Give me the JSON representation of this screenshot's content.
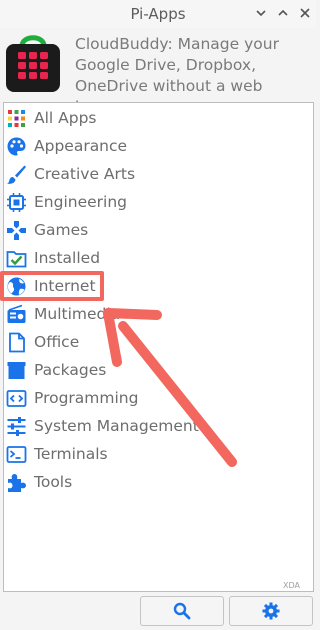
{
  "window": {
    "title": "Pi-Apps",
    "controls": [
      "chevron-down-icon",
      "chevron-up-icon",
      "close-icon"
    ]
  },
  "header": {
    "app_icon": "pi-apps-store-bag-icon",
    "description": "CloudBuddy: Manage your Google Drive, Dropbox, OneDrive without a web browser."
  },
  "categories": [
    {
      "label": "All Apps",
      "icon": "grid-icon"
    },
    {
      "label": "Appearance",
      "icon": "palette-icon"
    },
    {
      "label": "Creative Arts",
      "icon": "brush-icon"
    },
    {
      "label": "Engineering",
      "icon": "chip-icon"
    },
    {
      "label": "Games",
      "icon": "gamepad-icon"
    },
    {
      "label": "Installed",
      "icon": "installed-folder-icon"
    },
    {
      "label": "Internet",
      "icon": "globe-icon"
    },
    {
      "label": "Multimedia",
      "icon": "radio-icon"
    },
    {
      "label": "Office",
      "icon": "document-icon"
    },
    {
      "label": "Packages",
      "icon": "package-icon"
    },
    {
      "label": "Programming",
      "icon": "code-icon"
    },
    {
      "label": "System Management",
      "icon": "sliders-icon"
    },
    {
      "label": "Terminals",
      "icon": "terminal-icon"
    },
    {
      "label": "Tools",
      "icon": "puzzle-icon"
    }
  ],
  "annotation": {
    "highlighted_item": "Internet",
    "color": "#f2675e"
  },
  "watermark": "XDA",
  "footer": {
    "buttons": [
      "search-icon",
      "gear-icon"
    ]
  },
  "colors": {
    "icon_blue": "#1a73e8",
    "text": "#6d6d6d",
    "accent_red": "#f2675e"
  }
}
